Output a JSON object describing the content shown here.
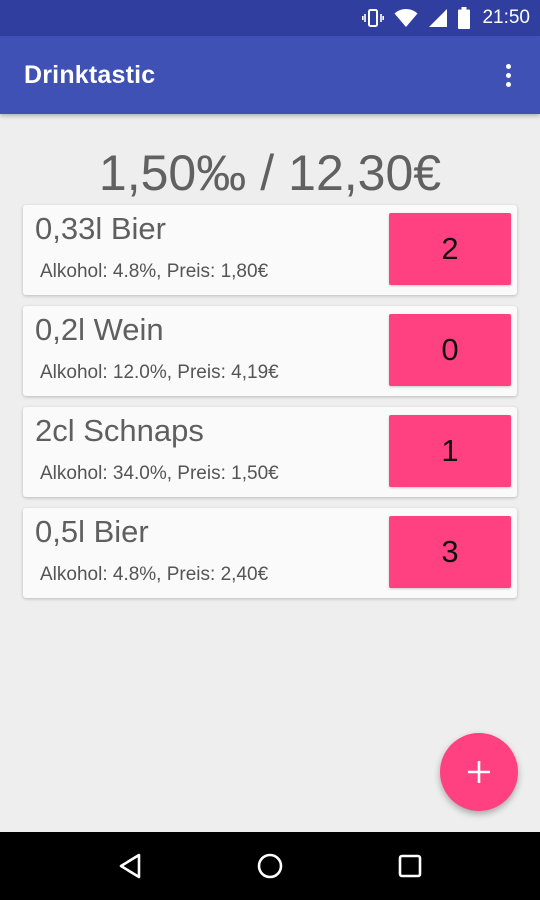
{
  "status_bar": {
    "time": "21:50",
    "icons": [
      "vibrate-icon",
      "wifi-icon",
      "signal-icon",
      "battery-icon"
    ]
  },
  "app_bar": {
    "title": "Drinktastic",
    "menu_icon": "overflow-menu-icon"
  },
  "summary": {
    "promille": "1,50‰",
    "separator": "/",
    "total": "12,30€"
  },
  "drinks": [
    {
      "name": "0,33l Bier",
      "info": "Alkohol: 4.8%, Preis: 1,80€",
      "count": "2"
    },
    {
      "name": "0,2l Wein",
      "info": "Alkohol: 12.0%, Preis: 4,19€",
      "count": "0"
    },
    {
      "name": "2cl Schnaps",
      "info": "Alkohol: 34.0%, Preis: 1,50€",
      "count": "1"
    },
    {
      "name": "0,5l Bier",
      "info": "Alkohol: 4.8%, Preis: 2,40€",
      "count": "3"
    }
  ],
  "fab": {
    "icon": "plus-icon"
  },
  "nav_bar": {
    "icons": [
      "back-icon",
      "home-icon",
      "recents-icon"
    ]
  },
  "colors": {
    "primary": "#3f51b5",
    "primary_dark": "#303f9f",
    "accent": "#ff4081",
    "background": "#eeeeee"
  }
}
